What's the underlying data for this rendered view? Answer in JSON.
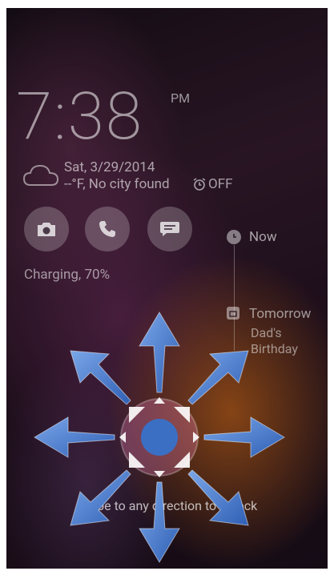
{
  "lockscreen": {
    "time": "7:38",
    "ampm": "PM",
    "date": "Sat, 3/29/2014",
    "weather": "--°F, No city found",
    "alarm": "OFF",
    "charging": "Charging, 70%"
  },
  "shortcuts": {
    "camera_icon": "camera-icon",
    "phone_icon": "phone-icon",
    "messages_icon": "message-icon"
  },
  "timeline": {
    "now_label": "Now",
    "tomorrow_label": "Tomorrow",
    "event_title": "Dad's Birthday"
  },
  "unlock": {
    "hint": "Swipe to any direction to unlock",
    "handle_color": "#3b6fc4",
    "arrow_color": "#4a7fd0"
  }
}
